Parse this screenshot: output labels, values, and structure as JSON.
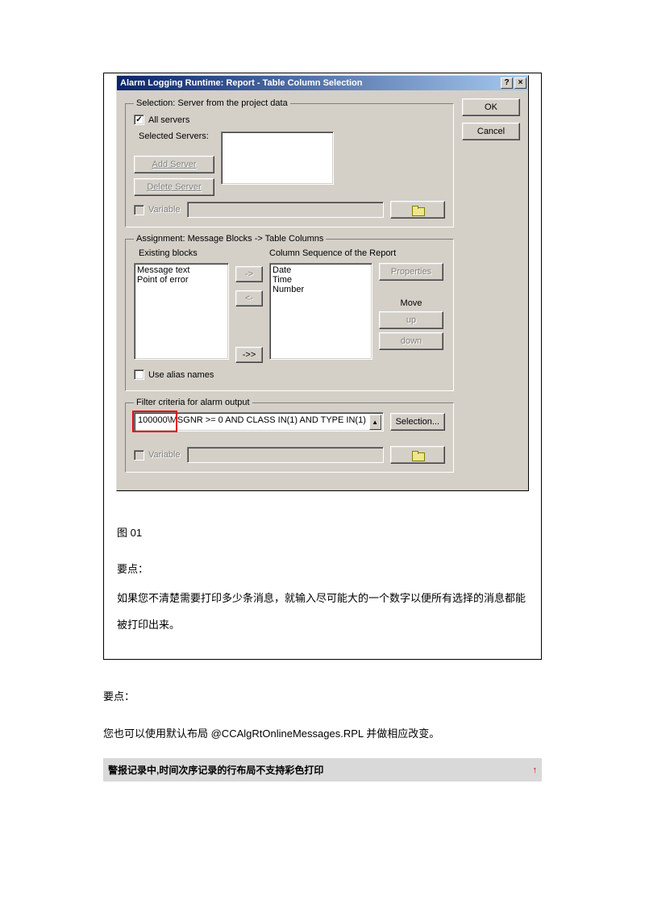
{
  "dialog": {
    "title": "Alarm Logging Runtime: Report - Table Column Selection",
    "help_btn": "?",
    "close_btn": "×",
    "ok": "OK",
    "cancel": "Cancel",
    "group_selection": {
      "legend": "Selection: Server from the project data",
      "all_servers": "All servers",
      "all_servers_checked": true,
      "selected_servers_label": "Selected Servers:",
      "add_server": "Add Server",
      "delete_server": "Delete Server",
      "variable": "Variable"
    },
    "group_assignment": {
      "legend": "Assignment: Message Blocks -> Table Columns",
      "existing_label": "Existing blocks",
      "column_seq_label": "Column Sequence of the Report",
      "existing_blocks": [
        "Message text",
        "Point of error"
      ],
      "report_columns": [
        "Date",
        "Time",
        "Number"
      ],
      "move_right": "->",
      "move_left": "<-",
      "move_all_right": "->>",
      "properties": "Properties",
      "move_label": "Move",
      "move_up": "up",
      "move_down": "down",
      "use_alias": "Use alias names"
    },
    "group_filter": {
      "legend": "Filter criteria for alarm output",
      "filter_prefix": "100000\\",
      "filter_text": "MSGNR >= 0 AND CLASS IN(1) AND TYPE IN(1)",
      "selection_btn": "Selection...",
      "variable": "Variable"
    }
  },
  "doc": {
    "fig_label": "图 01",
    "point_label": "要点：",
    "para1": "如果您不清楚需要打印多少条消息，就输入尽可能大的一个数字以便所有选择的消息都能被打印出来。",
    "para2": "您也可以使用默认布局  @CCAlgRtOnlineMessages.RPL  并做相应改变。",
    "gray_bar": "警报记录中,时间次序记录的行布局不支持彩色打印",
    "up_arrow": "↑"
  }
}
